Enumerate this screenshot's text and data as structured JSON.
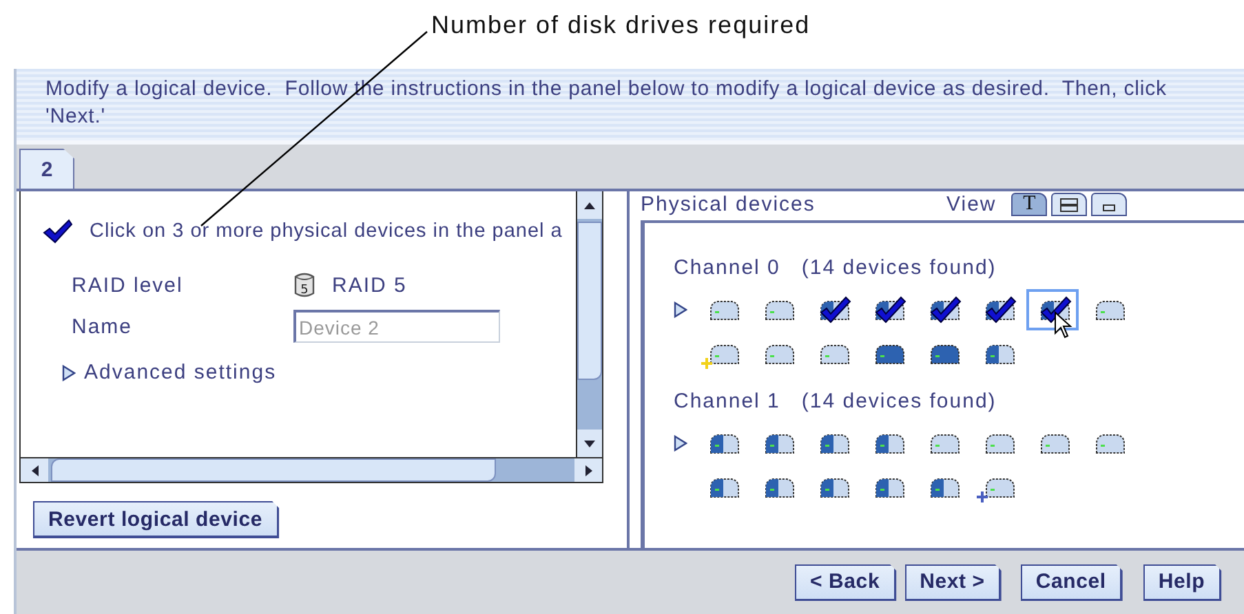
{
  "callout": "Number of disk drives required",
  "banner": "Modify a logical device.  Follow the instructions in the panel below to modify a logical device as desired.  Then, click 'Next.'",
  "tabs": [
    {
      "label": "2",
      "selected": true
    }
  ],
  "settings": {
    "instruction": "Click on 3 or more physical devices in the panel a",
    "raid_label": "RAID level",
    "raid_icon_text": "5",
    "raid_value": "RAID 5",
    "name_label": "Name",
    "name_value": "Device 2",
    "name_disabled": true,
    "advanced": {
      "label": "Advanced settings",
      "expanded": false
    }
  },
  "revert_button": "Revert logical device",
  "physical": {
    "title": "Physical devices",
    "view_label": "View",
    "view_buttons": [
      {
        "kind": "text",
        "label": "T",
        "selected": true
      },
      {
        "kind": "list",
        "selected": false
      },
      {
        "kind": "details",
        "selected": false
      }
    ],
    "channels": [
      {
        "name": "Channel 0",
        "count": "(14 devices found)",
        "expanded": false,
        "rows": [
          [
            {
              "kind": "empty",
              "checked": false,
              "focused": false
            },
            {
              "kind": "empty",
              "checked": false,
              "focused": false
            },
            {
              "kind": "half",
              "checked": true,
              "focused": false
            },
            {
              "kind": "half",
              "checked": true,
              "focused": false
            },
            {
              "kind": "half",
              "checked": true,
              "focused": false
            },
            {
              "kind": "half",
              "checked": true,
              "focused": false
            },
            {
              "kind": "half",
              "checked": true,
              "focused": true
            },
            {
              "kind": "empty",
              "checked": false,
              "focused": false
            }
          ],
          [
            {
              "kind": "empty",
              "checked": false,
              "focused": false,
              "color": "#f2d21b"
            },
            {
              "kind": "empty",
              "checked": false,
              "focused": false
            },
            {
              "kind": "empty",
              "checked": false,
              "focused": false
            },
            {
              "kind": "full",
              "checked": false,
              "focused": false
            },
            {
              "kind": "full",
              "checked": false,
              "focused": false
            },
            {
              "kind": "half",
              "checked": false,
              "focused": false
            }
          ]
        ]
      },
      {
        "name": "Channel 1",
        "count": "(14 devices found)",
        "expanded": false,
        "rows": [
          [
            {
              "kind": "half",
              "checked": false,
              "focused": false
            },
            {
              "kind": "half",
              "checked": false,
              "focused": false
            },
            {
              "kind": "half",
              "checked": false,
              "focused": false
            },
            {
              "kind": "half",
              "checked": false,
              "focused": false
            },
            {
              "kind": "empty",
              "checked": false,
              "focused": false
            },
            {
              "kind": "empty",
              "checked": false,
              "focused": false
            },
            {
              "kind": "empty",
              "checked": false,
              "focused": false
            },
            {
              "kind": "empty",
              "checked": false,
              "focused": false
            }
          ],
          [
            {
              "kind": "half",
              "checked": false,
              "focused": false
            },
            {
              "kind": "half",
              "checked": false,
              "focused": false
            },
            {
              "kind": "half",
              "checked": false,
              "focused": false
            },
            {
              "kind": "half",
              "checked": false,
              "focused": false
            },
            {
              "kind": "half",
              "checked": false,
              "focused": false
            },
            {
              "kind": "empty",
              "checked": false,
              "focused": false,
              "color": "#4a5fc0"
            }
          ]
        ]
      }
    ]
  },
  "buttons": [
    "< Back",
    "Next >",
    "Cancel",
    "Help"
  ]
}
